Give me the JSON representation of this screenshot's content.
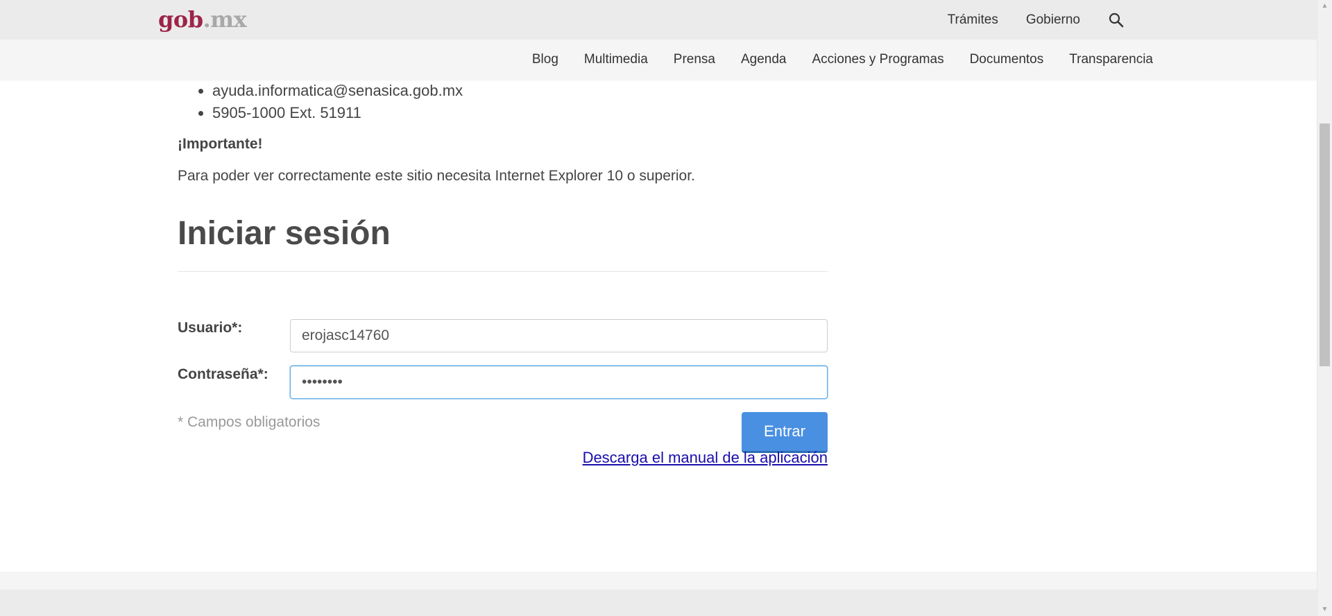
{
  "header": {
    "logo_gob": "gob",
    "logo_dot": ".",
    "logo_mx": "mx",
    "nav": [
      {
        "label": "Trámites"
      },
      {
        "label": "Gobierno"
      }
    ],
    "search_icon": "search-icon"
  },
  "subnav": {
    "items": [
      {
        "label": "Blog"
      },
      {
        "label": "Multimedia"
      },
      {
        "label": "Prensa"
      },
      {
        "label": "Agenda"
      },
      {
        "label": "Acciones y Programas"
      },
      {
        "label": "Documentos"
      },
      {
        "label": "Transparencia"
      }
    ]
  },
  "contact": {
    "items": [
      "ayuda.informatica@senasica.gob.mx",
      "5905-1000 Ext. 51911"
    ]
  },
  "important": {
    "heading": "¡Importante!",
    "text": "Para poder ver correctamente este sitio necesita Internet Explorer 10 o superior."
  },
  "login": {
    "title": "Iniciar sesión",
    "user_label": "Usuario*:",
    "user_value": "erojasc14760",
    "password_label": "Contraseña*:",
    "password_value": "••••••••",
    "required_note": "* Campos obligatorios",
    "submit_label": "Entrar",
    "manual_link": "Descarga el manual de la aplicación"
  },
  "colors": {
    "brand": "#9d2449",
    "button": "#4a90e2",
    "link": "#1a0dab"
  }
}
